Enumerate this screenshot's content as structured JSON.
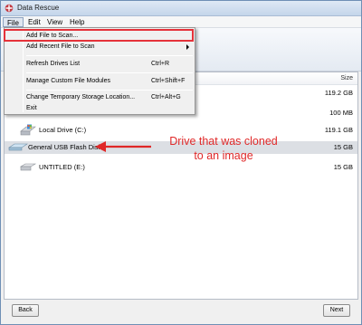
{
  "window": {
    "title": "Data Rescue"
  },
  "menubar": {
    "items": [
      "File",
      "Edit",
      "View",
      "Help"
    ]
  },
  "file_menu": {
    "items": [
      {
        "label": "Add File to Scan...",
        "shortcut": ""
      },
      {
        "label": "Add Recent File to Scan",
        "shortcut": ""
      },
      {
        "label": "Refresh Drives List",
        "shortcut": "Ctrl+R"
      },
      {
        "label": "Manage Custom File Modules",
        "shortcut": "Ctrl+Shift+F"
      },
      {
        "label": "Change Temporary Storage Location...",
        "shortcut": "Ctrl+Alt+G"
      },
      {
        "label": "Exit",
        "shortcut": ""
      }
    ]
  },
  "list": {
    "size_header": "Size",
    "rows": [
      {
        "name": "",
        "size": "119.2 GB"
      },
      {
        "name": "",
        "size": "100 MB"
      },
      {
        "name": "Local Drive (C:)",
        "size": "119.1 GB"
      },
      {
        "name": "General USB Flash Disk",
        "size": "15 GB"
      },
      {
        "name": "UNTITLED (E:)",
        "size": "15 GB"
      }
    ]
  },
  "annotation": {
    "line1": "Drive that was cloned",
    "line2": "to an image"
  },
  "buttons": {
    "back": "Back",
    "next": "Next"
  },
  "colors": {
    "annotation": "#e02828",
    "titlebar": "#c4d5ea",
    "selection": "#dcdfe4"
  }
}
